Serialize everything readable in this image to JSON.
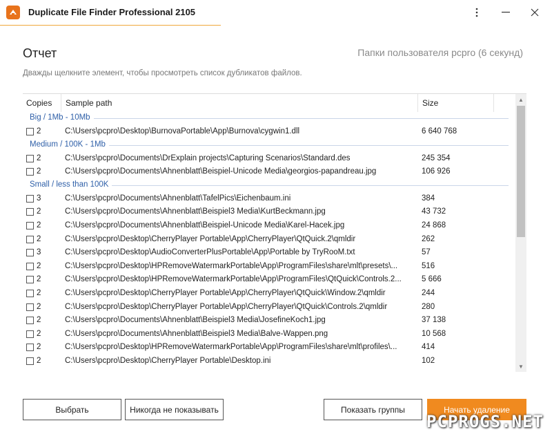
{
  "window": {
    "title": "Duplicate File Finder Professional 2105",
    "accent_color": "#f08a1f"
  },
  "header": {
    "title": "Отчет",
    "subtitle": "Папки пользователя pcpro (6 секунд)",
    "hint": "Дважды щелкните элемент, чтобы просмотреть список дубликатов файлов."
  },
  "table": {
    "columns": {
      "copies": "Copies",
      "path": "Sample path",
      "size": "Size"
    },
    "groups": [
      {
        "label": "Big / 1Mb - 10Mb",
        "rows": [
          {
            "copies": "2",
            "path": "C:\\Users\\pcpro\\Desktop\\BurnovaPortable\\App\\Burnova\\cygwin1.dll",
            "size": "6 640 768"
          }
        ]
      },
      {
        "label": "Medium / 100K - 1Mb",
        "rows": [
          {
            "copies": "2",
            "path": "C:\\Users\\pcpro\\Documents\\DrExplain projects\\Capturing Scenarios\\Standard.des",
            "size": "245 354"
          },
          {
            "copies": "2",
            "path": "C:\\Users\\pcpro\\Documents\\Ahnenblatt\\Beispiel-Unicode Media\\georgios-papandreau.jpg",
            "size": "106 926"
          }
        ]
      },
      {
        "label": "Small / less than 100K",
        "rows": [
          {
            "copies": "3",
            "path": "C:\\Users\\pcpro\\Documents\\Ahnenblatt\\TafelPics\\Eichenbaum.ini",
            "size": "384"
          },
          {
            "copies": "2",
            "path": "C:\\Users\\pcpro\\Documents\\Ahnenblatt\\Beispiel3 Media\\KurtBeckmann.jpg",
            "size": "43 732"
          },
          {
            "copies": "2",
            "path": "C:\\Users\\pcpro\\Documents\\Ahnenblatt\\Beispiel-Unicode Media\\Karel-Hacek.jpg",
            "size": "24 868"
          },
          {
            "copies": "2",
            "path": "C:\\Users\\pcpro\\Desktop\\CherryPlayer Portable\\App\\CherryPlayer\\QtQuick.2\\qmldir",
            "size": "262"
          },
          {
            "copies": "3",
            "path": "C:\\Users\\pcpro\\Desktop\\AudioConverterPlusPortable\\App\\Portable by TryRooM.txt",
            "size": "57"
          },
          {
            "copies": "2",
            "path": "C:\\Users\\pcpro\\Desktop\\HPRemoveWatermarkPortable\\App\\ProgramFiles\\share\\mlt\\presets\\...",
            "size": "516"
          },
          {
            "copies": "2",
            "path": "C:\\Users\\pcpro\\Desktop\\HPRemoveWatermarkPortable\\App\\ProgramFiles\\QtQuick\\Controls.2...",
            "size": "5 666"
          },
          {
            "copies": "2",
            "path": "C:\\Users\\pcpro\\Desktop\\CherryPlayer Portable\\App\\CherryPlayer\\QtQuick\\Window.2\\qmldir",
            "size": "244"
          },
          {
            "copies": "2",
            "path": "C:\\Users\\pcpro\\Desktop\\CherryPlayer Portable\\App\\CherryPlayer\\QtQuick\\Controls.2\\qmldir",
            "size": "280"
          },
          {
            "copies": "2",
            "path": "C:\\Users\\pcpro\\Documents\\Ahnenblatt\\Beispiel3 Media\\JosefineKoch1.jpg",
            "size": "37 138"
          },
          {
            "copies": "2",
            "path": "C:\\Users\\pcpro\\Documents\\Ahnenblatt\\Beispiel3 Media\\Balve-Wappen.png",
            "size": "10 568"
          },
          {
            "copies": "2",
            "path": "C:\\Users\\pcpro\\Desktop\\HPRemoveWatermarkPortable\\App\\ProgramFiles\\share\\mlt\\profiles\\...",
            "size": "414"
          },
          {
            "copies": "2",
            "path": "C:\\Users\\pcpro\\Desktop\\CherryPlayer Portable\\Desktop.ini",
            "size": "102"
          }
        ]
      }
    ]
  },
  "buttons": {
    "select": "Выбрать",
    "never_show": "Никогда не показывать",
    "show_groups": "Показать группы",
    "primary": "Начать удаление"
  },
  "watermark": "PCPROGS.NET",
  "icons": [
    "app-icon",
    "more-icon",
    "minimize-icon",
    "close-icon",
    "scroll-up-icon",
    "scroll-down-icon",
    "checkbox-icon"
  ]
}
